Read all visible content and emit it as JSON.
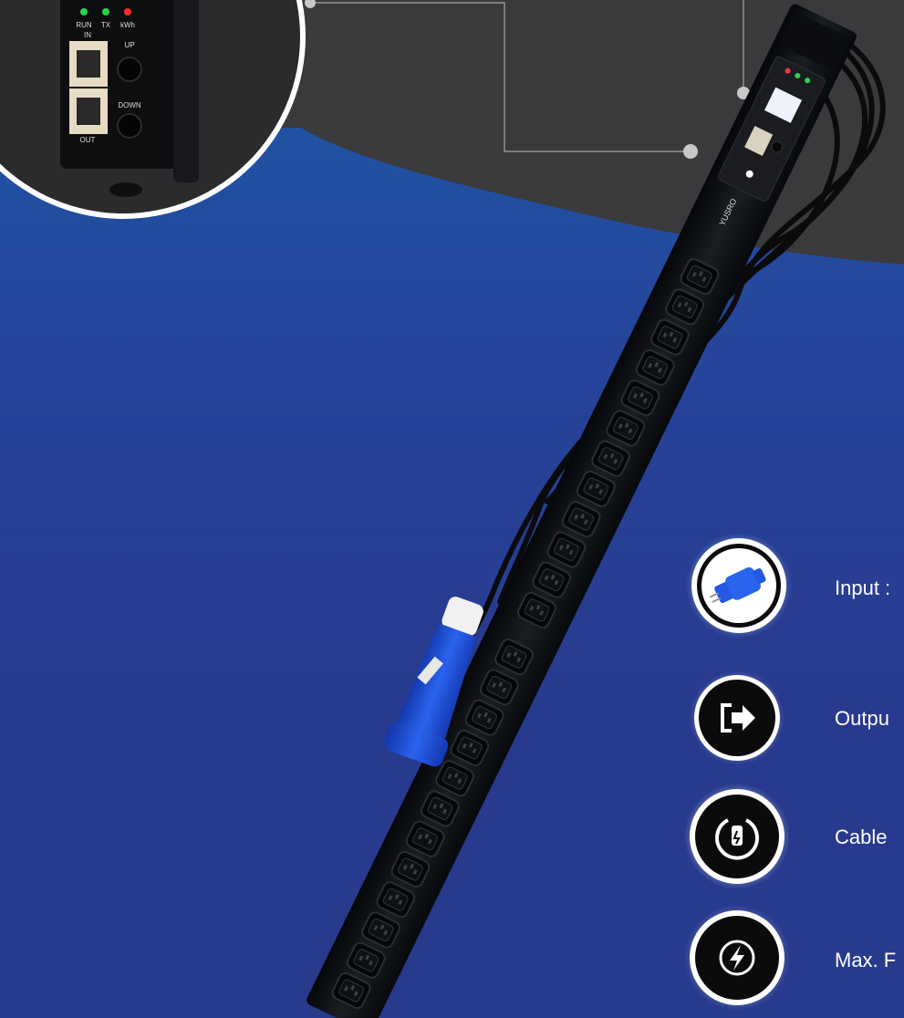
{
  "inset": {
    "led_labels": [
      "RUN",
      "TX",
      "kWh"
    ],
    "port_in_label": "IN",
    "port_out_label": "OUT",
    "button_up_label": "UP",
    "button_down_label": "DOWN"
  },
  "product": {
    "brand_text": "YUSRO",
    "outlet_count": 24,
    "colors": {
      "background_top": "#1f5aa6",
      "background_bottom": "#273a8c",
      "dark_band": "#3a3a3c",
      "pdu_body": "#101216",
      "plug_blue": "#1e4fd8"
    }
  },
  "specs": [
    {
      "label": "Input :",
      "icon": "plug-connector-icon"
    },
    {
      "label": "Outpu",
      "icon": "output-arrow-icon"
    },
    {
      "label": "Cable",
      "icon": "cable-plug-icon"
    },
    {
      "label": "Max. F",
      "icon": "lightning-bolt-icon"
    }
  ]
}
